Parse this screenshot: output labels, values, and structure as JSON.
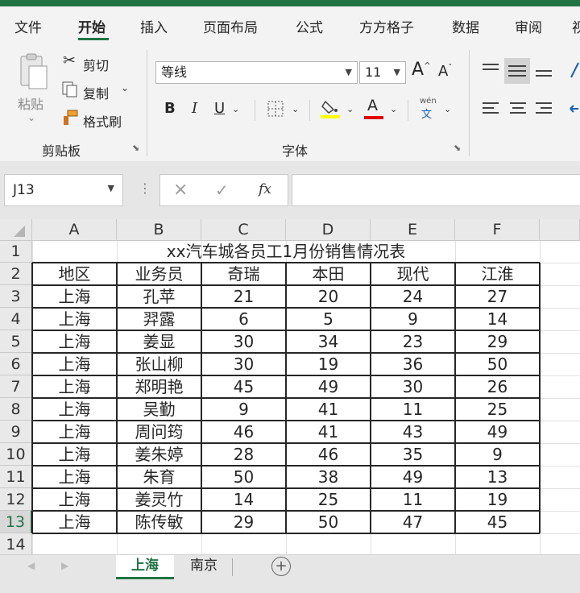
{
  "ribbon": {
    "tabs": [
      "文件",
      "开始",
      "插入",
      "页面布局",
      "公式",
      "方方格子",
      "数据",
      "审阅",
      "视"
    ],
    "active_tab": "开始",
    "clipboard": {
      "paste": "粘贴",
      "cut": "剪切",
      "copy": "复制",
      "format_painter": "格式刷",
      "group_label": "剪贴板"
    },
    "font": {
      "font_name": "等线",
      "font_size": "11",
      "bold": "B",
      "italic": "I",
      "underline": "U",
      "pinyin_top": "wén",
      "pinyin_bottom": "文",
      "group_label": "字体",
      "grow": "A",
      "shrink": "A",
      "font_color_glyph": "A",
      "highlight_color": "#ffff00",
      "font_color": "#e00000"
    },
    "accent_color": "#217346"
  },
  "formula_bar": {
    "name_box": "J13",
    "formula": "",
    "cancel_glyph": "×",
    "enter_glyph": "✓",
    "fx_glyph": "fx"
  },
  "sheet": {
    "columns": [
      "A",
      "B",
      "C",
      "D",
      "E",
      "F"
    ],
    "row_numbers": [
      "1",
      "2",
      "3",
      "4",
      "5",
      "6",
      "7",
      "8",
      "9",
      "10",
      "11",
      "12",
      "13",
      "14"
    ],
    "title": "xx汽车城各员工1月份销售情况表",
    "headers": [
      "地区",
      "业务员",
      "奇瑞",
      "本田",
      "现代",
      "江淮"
    ],
    "rows": [
      [
        "上海",
        "孔苹",
        "21",
        "20",
        "24",
        "27"
      ],
      [
        "上海",
        "羿露",
        "6",
        "5",
        "9",
        "14"
      ],
      [
        "上海",
        "姜显",
        "30",
        "34",
        "23",
        "29"
      ],
      [
        "上海",
        "张山柳",
        "30",
        "19",
        "36",
        "50"
      ],
      [
        "上海",
        "郑明艳",
        "45",
        "49",
        "30",
        "26"
      ],
      [
        "上海",
        "吴勤",
        "9",
        "41",
        "11",
        "25"
      ],
      [
        "上海",
        "周问筠",
        "46",
        "41",
        "43",
        "49"
      ],
      [
        "上海",
        "姜朱婷",
        "28",
        "46",
        "35",
        "9"
      ],
      [
        "上海",
        "朱育",
        "50",
        "38",
        "49",
        "13"
      ],
      [
        "上海",
        "姜灵竹",
        "14",
        "25",
        "11",
        "19"
      ],
      [
        "上海",
        "陈传敏",
        "29",
        "50",
        "47",
        "45"
      ]
    ]
  },
  "sheet_tabs": {
    "tabs": [
      "上海",
      "南京"
    ],
    "active": "上海",
    "add_glyph": "+"
  }
}
